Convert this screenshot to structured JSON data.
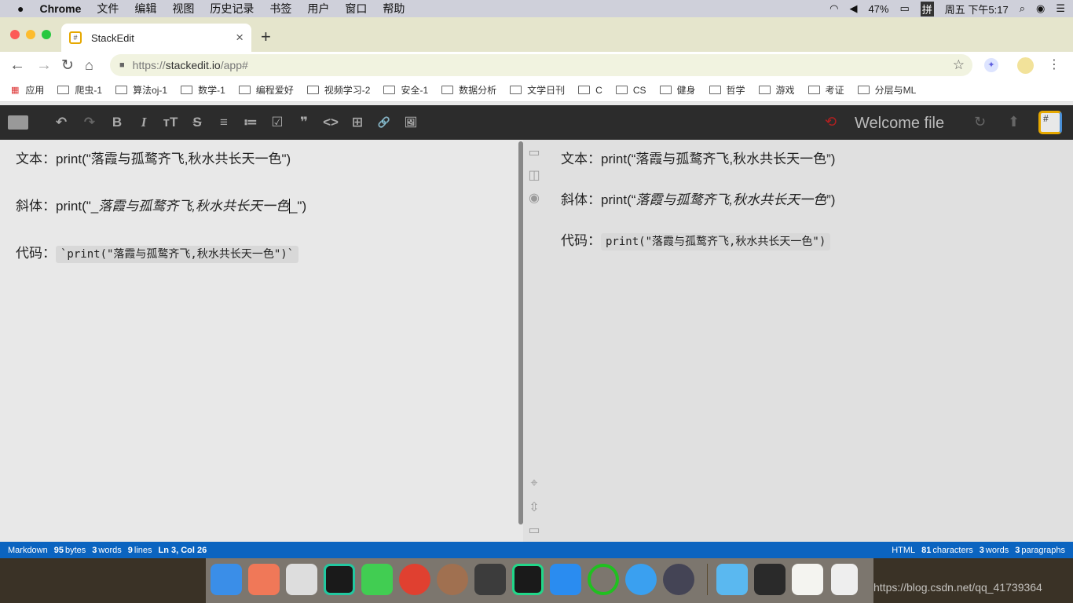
{
  "menubar": {
    "apple": "",
    "app": "Chrome",
    "items": [
      "文件",
      "编辑",
      "视图",
      "历史记录",
      "书签",
      "用户",
      "窗口",
      "帮助"
    ],
    "battery": "47%",
    "input": "拼",
    "clock": "周五 下午5:17"
  },
  "tab": {
    "title": "StackEdit",
    "favicon": "#",
    "close": "×",
    "new": "+"
  },
  "address": {
    "scheme": "https://",
    "host": "stackedit.io",
    "path": "/app#"
  },
  "bookmarks": {
    "apps": "应用",
    "items": [
      "爬虫-1",
      "算法oj-1",
      "数学-1",
      "编程爱好",
      "视频学习-2",
      "安全-1",
      "数据分析",
      "文学日刊",
      "C",
      "CS",
      "健身",
      "哲学",
      "游戏",
      "考证",
      "分层与ML"
    ]
  },
  "navbar": {
    "tools": [
      "B",
      "I",
      "тT",
      "S",
      "≡",
      "≔",
      "☑",
      "❞",
      "<>",
      "⊞",
      "🔗",
      "🖼"
    ],
    "file_title": "Welcome file"
  },
  "editor": {
    "lines": [
      {
        "label": "文本：",
        "text": "print(\"落霞与孤鹜齐飞,秋水共长天一色\")"
      },
      {
        "label": "斜体：",
        "pre": "print(\"_",
        "italic": "落霞与孤鹜齐飞,秋水共长天一色",
        "post": "_\")"
      },
      {
        "label": "代码：",
        "code": "`print(\"落霞与孤鹜齐飞,秋水共长天一色\")`"
      }
    ]
  },
  "preview": {
    "lines": [
      {
        "label": "文本：",
        "text": "print(“落霞与孤鹜齐飞,秋水共长天一色”)"
      },
      {
        "label": "斜体：",
        "pre": "print(“",
        "italic": "落霞与孤鹜齐飞,秋水共长天一色",
        "post": "”)"
      },
      {
        "label": "代码：",
        "code": "print(\"落霞与孤鹜齐飞,秋水共长天一色\")"
      }
    ]
  },
  "statusbar": {
    "left": {
      "mode": "Markdown",
      "bytes": "95",
      "bytes_l": "bytes",
      "words": "3",
      "words_l": "words",
      "lines": "9",
      "lines_l": "lines",
      "pos": "Ln 3, Col 26"
    },
    "right": {
      "mode": "HTML",
      "chars": "81",
      "chars_l": "characters",
      "words": "3",
      "words_l": "words",
      "paras": "3",
      "paras_l": "paragraphs"
    }
  },
  "watermark": "https://blog.csdn.net/qq_41739364",
  "colors": {
    "statusbar": "#0b64c0",
    "navbar": "#2c2c2c",
    "sync_off": "#b02020"
  }
}
